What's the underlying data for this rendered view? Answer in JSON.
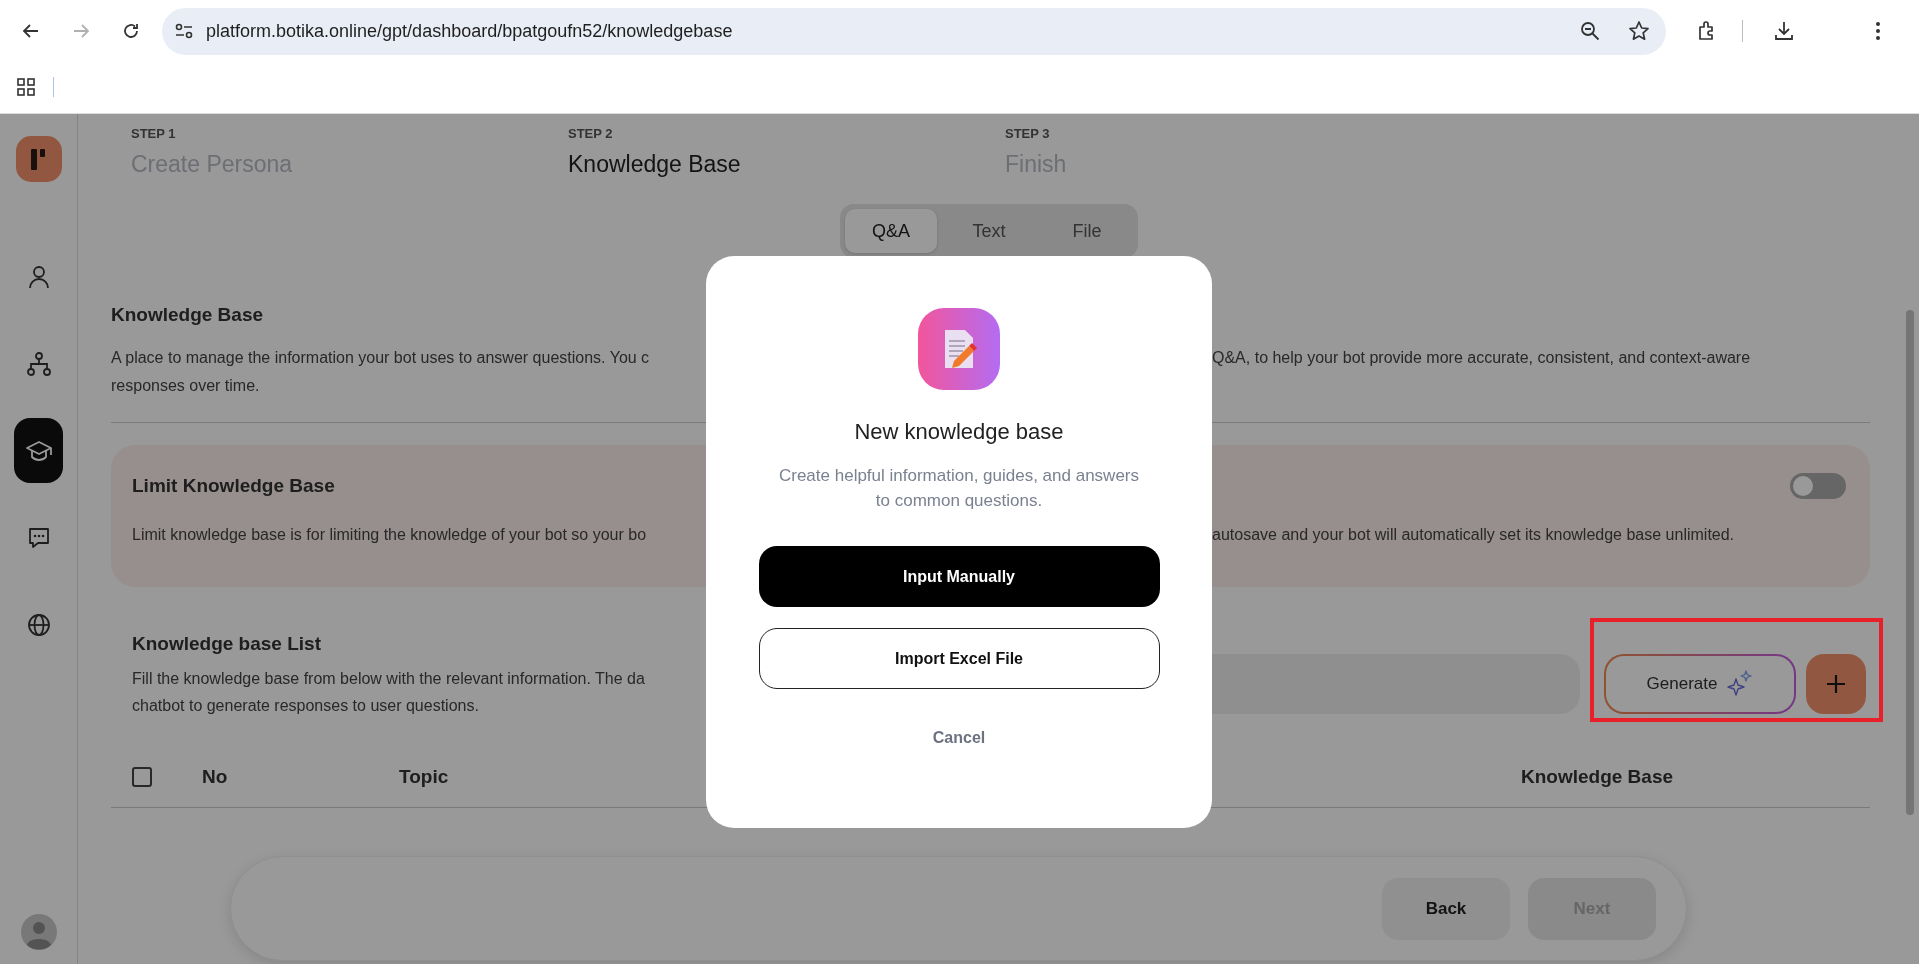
{
  "browser": {
    "url": "platform.botika.online/gpt/dashboard/bpatgoufn52/knowledgebase",
    "nav_buttons": [
      {
        "kind": "back",
        "disabled": false
      },
      {
        "kind": "forward",
        "disabled": true
      },
      {
        "kind": "reload",
        "disabled": false
      }
    ]
  },
  "sidebar": {
    "items": [
      {
        "kind": "persona",
        "selected": false
      },
      {
        "kind": "flow",
        "selected": false
      },
      {
        "kind": "knowledge",
        "selected": true
      },
      {
        "kind": "chat",
        "selected": false
      },
      {
        "kind": "web",
        "selected": false
      }
    ]
  },
  "steps": [
    {
      "label": "STEP 1",
      "title": "Create Persona",
      "selected": false
    },
    {
      "label": "STEP 2",
      "title": "Knowledge Base",
      "selected": true
    },
    {
      "label": "STEP 3",
      "title": "Finish",
      "selected": false
    }
  ],
  "tabs": [
    {
      "label": "Q&A",
      "selected": true
    },
    {
      "label": "Text",
      "selected": false
    },
    {
      "label": "File",
      "selected": false
    }
  ],
  "knowledge_base": {
    "title": "Knowledge Base",
    "description_lines": [
      {
        "left": "A place to manage the information your bot uses to answer questions. You c",
        "right": "Q&A, to help your bot provide more accurate, consistent, and context-aware"
      },
      {
        "left": "responses over time."
      }
    ]
  },
  "limit": {
    "title": "Limit Knowledge Base",
    "on": false,
    "description_lines": [
      {
        "left": "Limit knowledge base is for limiting the knowledge of your bot so your bo",
        "right": "autosave and your bot will automatically set its knowledge base unlimited."
      }
    ]
  },
  "list": {
    "title": "Knowledge base List",
    "description_lines": [
      "Fill the knowledge base from below with the relevant information. The da",
      "chatbot to generate responses to user questions."
    ],
    "generate": "Generate",
    "select_all": {
      "checked": false
    },
    "columns": [
      {
        "label": "No"
      },
      {
        "label": "Topic"
      },
      {
        "label": "Knowledge Base"
      }
    ]
  },
  "footer": {
    "back": "Back",
    "next": {
      "label": "Next",
      "disabled": true
    }
  },
  "modal": {
    "title": "New knowledge base",
    "description": "Create helpful information, guides, and answers to common questions.",
    "buttons": [
      {
        "label": "Input Manually",
        "kind": "primary"
      },
      {
        "label": "Import Excel File",
        "kind": "outline"
      }
    ],
    "cancel": "Cancel"
  }
}
